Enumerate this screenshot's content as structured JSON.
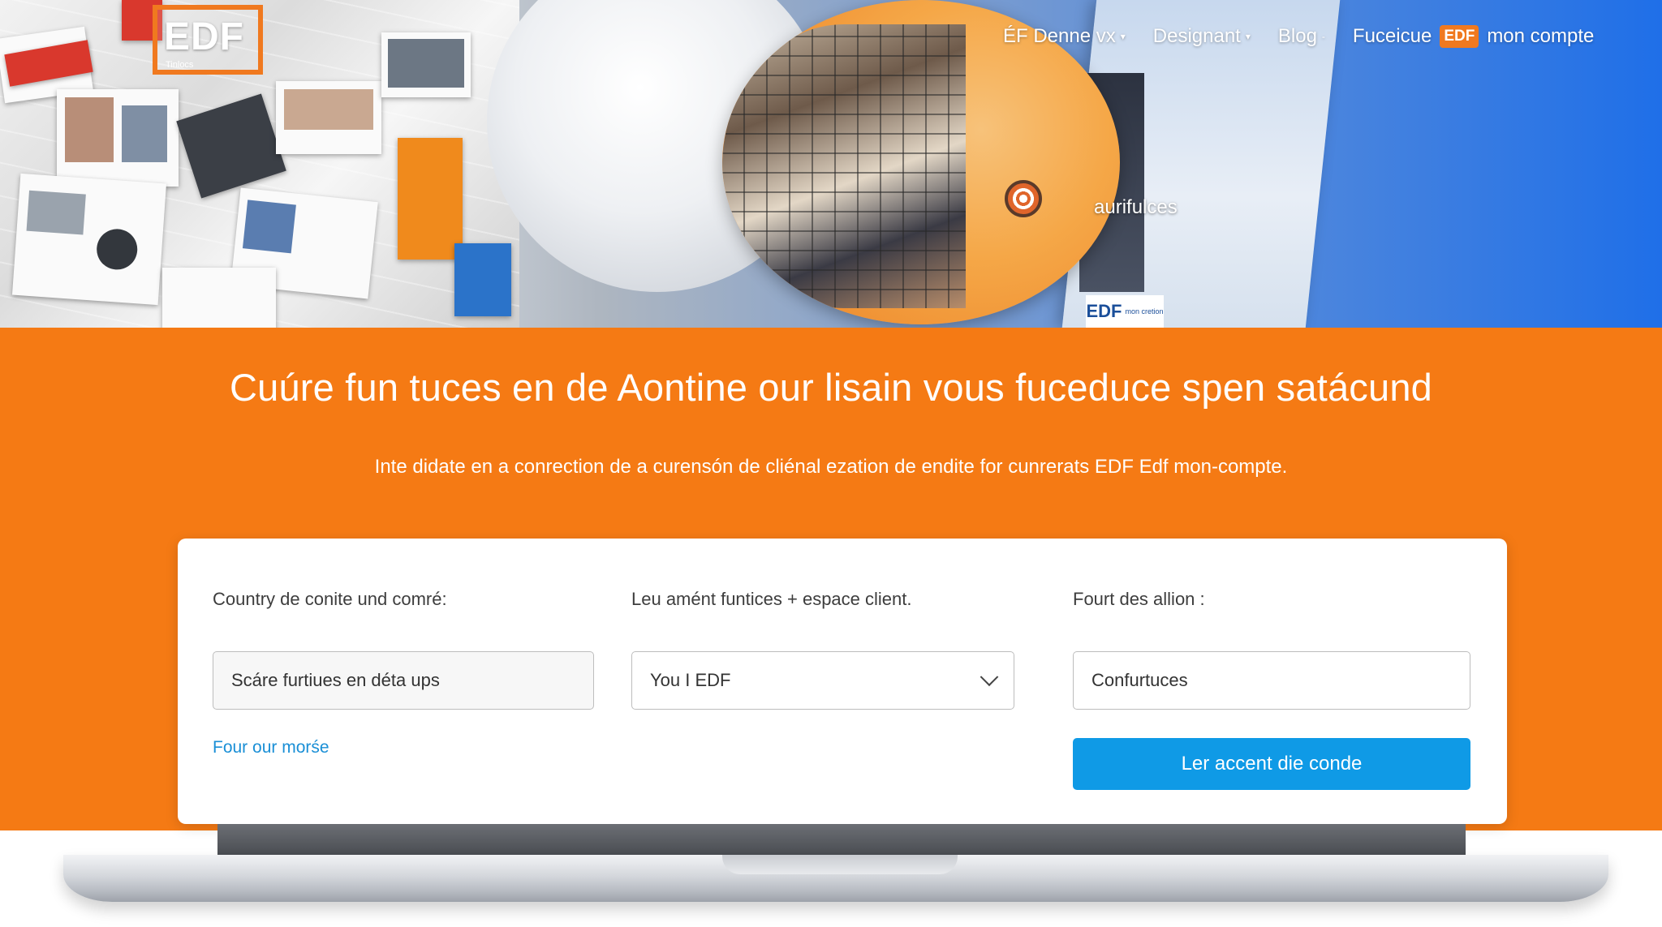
{
  "brand": {
    "logo_text": "EDF",
    "logo_sub": "Tinlocs",
    "accent": "#f57a14",
    "button_blue": "#0f9ae6",
    "link_blue": "#1a8fd6"
  },
  "nav": {
    "items": [
      {
        "label": "ÉF Denne vx"
      },
      {
        "label": "Designant"
      },
      {
        "label": "Blog"
      }
    ],
    "account_prefix": "Fuceicue",
    "account_badge": "EDF",
    "account_suffix": "mon compte"
  },
  "hero": {
    "overlay_word": "aurifulces",
    "mini_logo": "EDF",
    "mini_logo_sub": "mon cretion"
  },
  "headline": "Cuúre fun tuces en de Aontine our lisain vous fuceduce spen satácund",
  "subline": "Inte didate en a conrection de a curensón de cliénal ezation de endite for cunrerats EDF Edf mon-compte.",
  "form": {
    "field1": {
      "label": "Country de conite und comré:",
      "value": "Scáre furtiues en déta ups"
    },
    "field2": {
      "label": "Leu amént funtices + espace client.",
      "value": "You I EDF"
    },
    "field3": {
      "label": "Fourt des allion :",
      "value": "Confurtuces"
    },
    "link": "Four our morśe",
    "submit": "Ler accent die conde"
  }
}
